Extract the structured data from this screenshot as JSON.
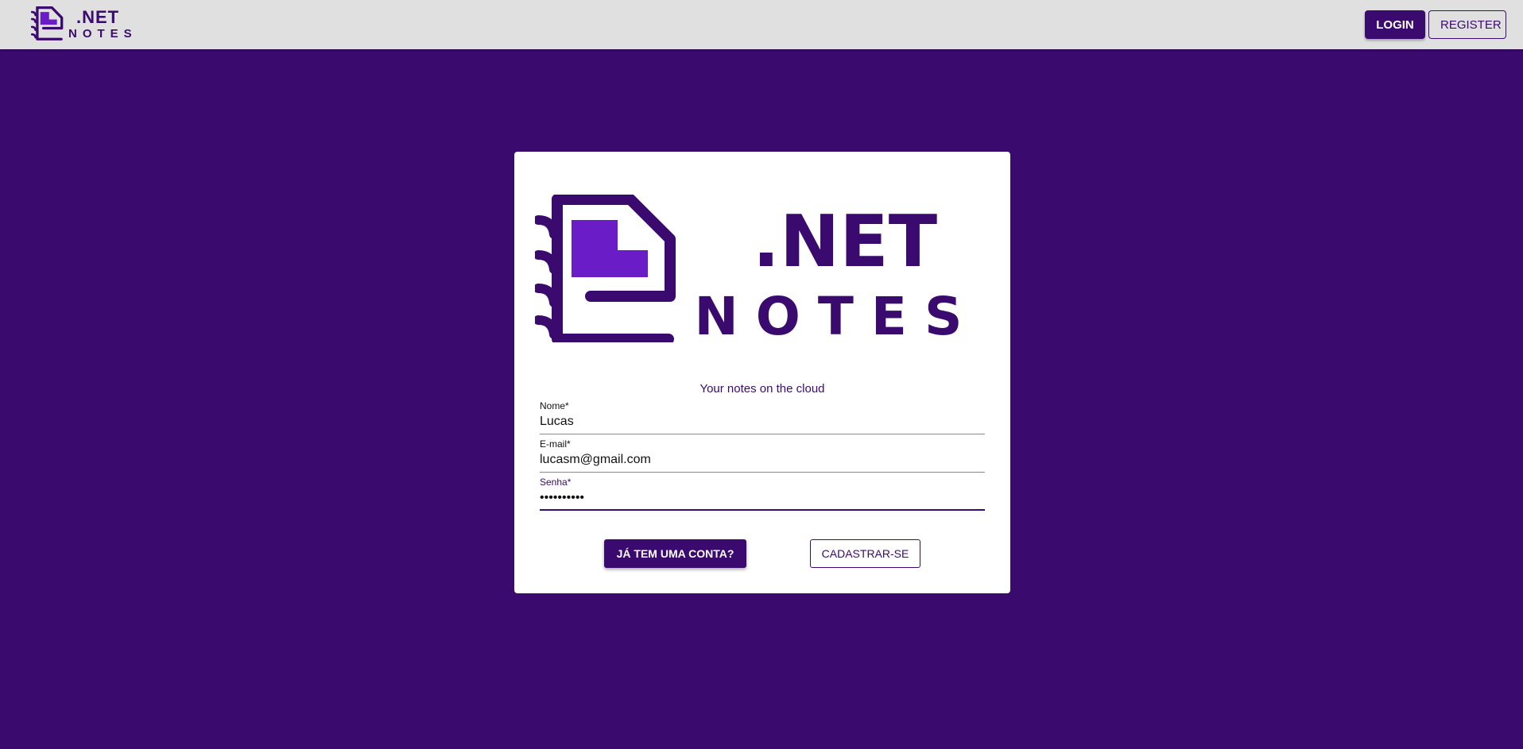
{
  "colors": {
    "brand": "#3a0a6e",
    "accent": "#6a1dc7",
    "topbar": "#e0e0e0",
    "card": "#ffffff"
  },
  "header": {
    "logo_line1": ".NET",
    "logo_line2": "NOTES",
    "logo_icon": "notebook-icon",
    "login_label": "LOGIN",
    "register_label": "REGISTER"
  },
  "card": {
    "logo_line1": ".NET",
    "logo_line2": "NOTES",
    "tagline": "Your notes on the cloud",
    "fields": [
      {
        "label": "Nome*",
        "value": "Lucas"
      },
      {
        "label": "E-mail*",
        "value": "lucasm@gmail.com"
      },
      {
        "label": "Senha*",
        "value": "••••••••••",
        "focused": true
      }
    ],
    "login_button": "JÁ TEM UMA CONTA?",
    "register_button": "CADASTRAR-SE"
  }
}
